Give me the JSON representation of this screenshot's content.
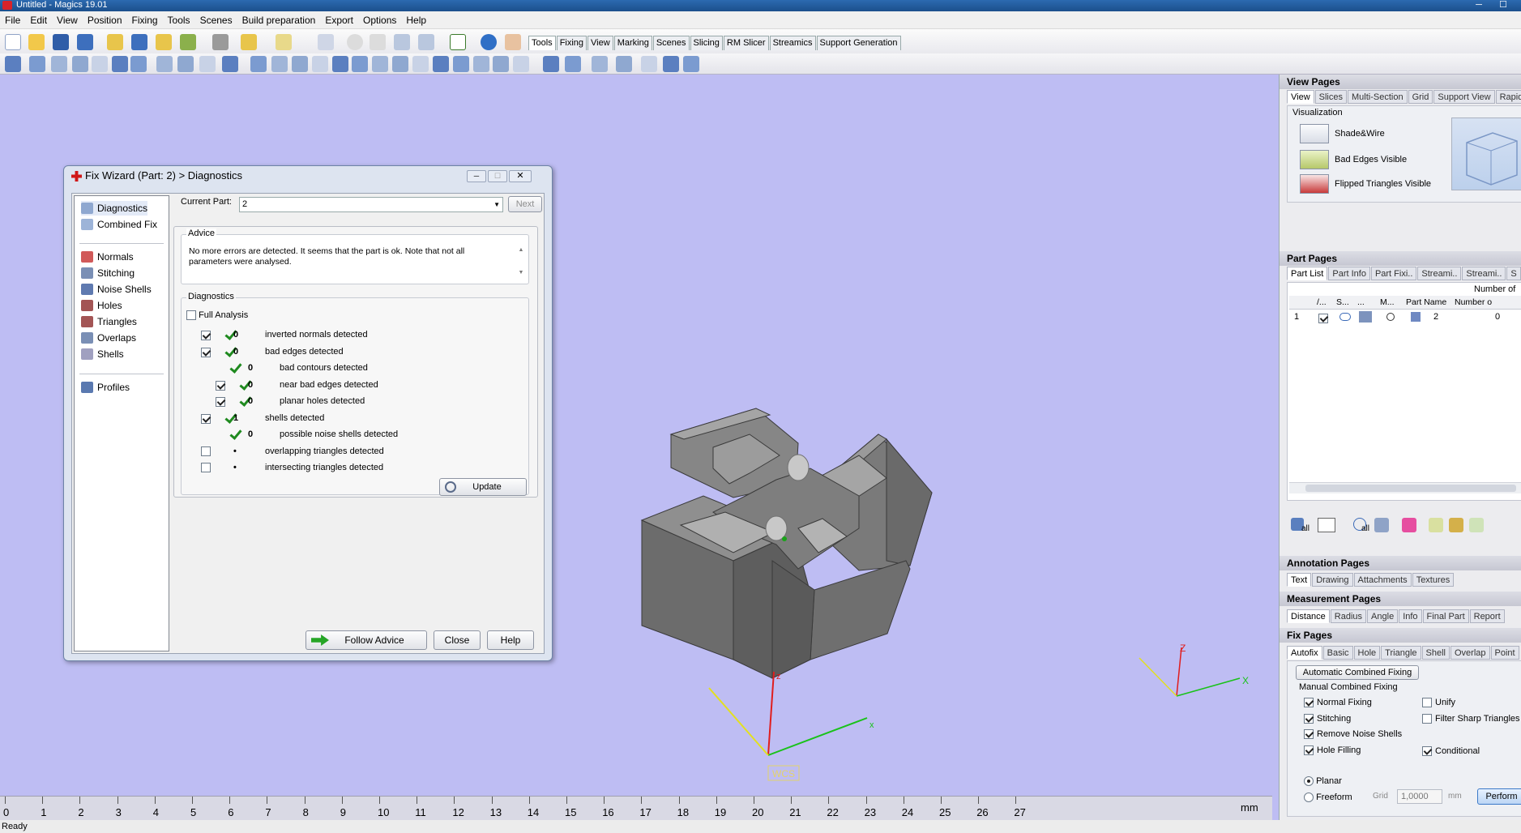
{
  "window": {
    "title": "Untitled - Magics 19.01",
    "min": "─",
    "max": "☐"
  },
  "menu": [
    "File",
    "Edit",
    "View",
    "Position",
    "Fixing",
    "Tools",
    "Scenes",
    "Build preparation",
    "Export",
    "Options",
    "Help"
  ],
  "toolbar_tabs": [
    "Tools",
    "Fixing",
    "View",
    "Marking",
    "Scenes",
    "Slicing",
    "RM Slicer",
    "Streamics",
    "Support Generation"
  ],
  "toolbar_tab_selected": "Tools",
  "dialog": {
    "title": "Fix Wizard (Part: 2) > Diagnostics",
    "nav": [
      "Diagnostics",
      "Combined Fix",
      "Normals",
      "Stitching",
      "Noise Shells",
      "Holes",
      "Triangles",
      "Overlaps",
      "Shells",
      "Profiles"
    ],
    "current_part_label": "Current Part:",
    "current_part_value": "2",
    "next_label": "Next",
    "advice_title": "Advice",
    "advice_text": "No more errors are detected. It seems that the part is ok. Note that not all parameters were analysed.",
    "diagnostics_title": "Diagnostics",
    "full_analysis": "Full Analysis",
    "rows": [
      {
        "count": "0",
        "label": "inverted normals detected",
        "checked": true,
        "ok": true,
        "indent": 0
      },
      {
        "count": "0",
        "label": "bad edges detected",
        "checked": true,
        "ok": true,
        "indent": 0
      },
      {
        "count": "0",
        "label": "bad contours detected",
        "checked": null,
        "ok": true,
        "indent": 1
      },
      {
        "count": "0",
        "label": "near bad edges detected",
        "checked": true,
        "ok": true,
        "indent": 1
      },
      {
        "count": "0",
        "label": "planar holes detected",
        "checked": true,
        "ok": true,
        "indent": 1
      },
      {
        "count": "1",
        "label": "shells detected",
        "checked": true,
        "ok": true,
        "indent": 0
      },
      {
        "count": "0",
        "label": "possible noise shells detected",
        "checked": null,
        "ok": true,
        "indent": 1
      },
      {
        "count": "•",
        "label": "overlapping triangles detected",
        "checked": false,
        "ok": false,
        "indent": 0
      },
      {
        "count": "•",
        "label": "intersecting triangles detected",
        "checked": false,
        "ok": false,
        "indent": 0
      }
    ],
    "update": "Update",
    "follow_advice": "Follow Advice",
    "close": "Close",
    "help": "Help"
  },
  "viewport": {
    "wcs_label": "WCS",
    "axis_x": "x",
    "axis_z": "z",
    "mini_x": "X",
    "mini_z": "Z"
  },
  "ruler": {
    "ticks": [
      "0",
      "1",
      "2",
      "3",
      "4",
      "5",
      "6",
      "7",
      "8",
      "9",
      "10",
      "11",
      "12",
      "13",
      "14",
      "15",
      "16",
      "17",
      "18",
      "19",
      "20",
      "21",
      "22",
      "23",
      "24",
      "25",
      "26",
      "27"
    ],
    "unit": "mm"
  },
  "status": "Ready",
  "panels": {
    "view_pages": {
      "title": "View Pages",
      "tabs": [
        "View",
        "Slices",
        "Multi-Section",
        "Grid",
        "Support View",
        "Rapidfit"
      ],
      "visualization": "Visualization",
      "items": [
        "Shade&Wire",
        "Bad Edges Visible",
        "Flipped Triangles Visible"
      ]
    },
    "part_pages": {
      "title": "Part Pages",
      "tabs": [
        "Part List",
        "Part Info",
        "Part Fixi..",
        "Streami..",
        "Streami..",
        "S"
      ],
      "number_of": "Number of p",
      "columns": [
        "",
        "/...",
        "S...",
        "...",
        "M...",
        "Part Name",
        "Number o"
      ],
      "row": {
        "index": "1",
        "name": "2",
        "number": "0"
      },
      "all1": "all",
      "all2": "all"
    },
    "annotation_pages": {
      "title": "Annotation Pages",
      "tabs": [
        "Text",
        "Drawing",
        "Attachments",
        "Textures"
      ]
    },
    "measurement_pages": {
      "title": "Measurement Pages",
      "tabs": [
        "Distance",
        "Radius",
        "Angle",
        "Info",
        "Final Part",
        "Report"
      ]
    },
    "fix_pages": {
      "title": "Fix Pages",
      "tabs": [
        "Autofix",
        "Basic",
        "Hole",
        "Triangle",
        "Shell",
        "Overlap",
        "Point"
      ],
      "auto_btn": "Automatic Combined Fixing",
      "manual": "Manual Combined Fixing",
      "left_opts": [
        {
          "label": "Normal Fixing",
          "on": true
        },
        {
          "label": "Stitching",
          "on": true
        },
        {
          "label": "Remove Noise Shells",
          "on": true
        },
        {
          "label": "Hole Filling",
          "on": true
        }
      ],
      "right_opts": [
        {
          "label": "Unify",
          "on": false
        },
        {
          "label": "Filter Sharp Triangles",
          "on": false
        },
        {
          "label": "Conditional",
          "on": true
        }
      ],
      "planar": "Planar",
      "freeform": "Freeform",
      "grid_label": "Grid",
      "grid_value": "1,0000",
      "grid_unit": "mm",
      "perform": "Perform"
    }
  },
  "colors": {
    "viewport": "#bebdf3",
    "accent": "#1b4f8c",
    "check": "#1f8a1f"
  }
}
